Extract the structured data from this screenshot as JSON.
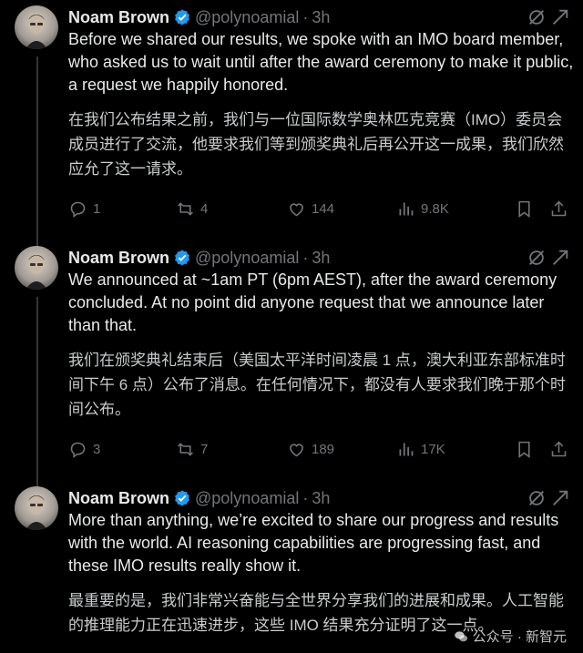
{
  "tweets": [
    {
      "author": "Noam Brown",
      "handle": "@polynoamial",
      "separator": "·",
      "time": "3h",
      "text_en": "Before we shared our results, we spoke with an IMO board member, who asked us to wait until after the award ceremony to make it public, a request we happily honored.",
      "text_zh": "在我们公布结果之前，我们与一位国际数学奥林匹克竞赛（IMO）委员会成员进行了交流，他要求我们等到颁奖典礼后再公开这一成果，我们欣然应允了这一请求。",
      "replies": "1",
      "reposts": "4",
      "likes": "144",
      "views": "9.8K"
    },
    {
      "author": "Noam Brown",
      "handle": "@polynoamial",
      "separator": "·",
      "time": "3h",
      "text_en": "We announced at ~1am PT (6pm AEST), after the award ceremony concluded. At no point did anyone request that we announce later than that.",
      "text_zh": "我们在颁奖典礼结束后（美国太平洋时间凌晨 1 点，澳大利亚东部标准时间下午 6 点）公布了消息。在任何情况下，都没有人要求我们晚于那个时间公布。",
      "replies": "3",
      "reposts": "7",
      "likes": "189",
      "views": "17K"
    },
    {
      "author": "Noam Brown",
      "handle": "@polynoamial",
      "separator": "·",
      "time": "3h",
      "text_en": "More than anything, we’re excited to share our progress and results with the world. AI reasoning capabilities are progressing fast, and these IMO results really show it.",
      "text_zh": "最重要的是，我们非常兴奋能与全世界分享我们的进展和成果。人工智能的推理能力正在迅速进步，这些 IMO 结果充分证明了这一点。"
    }
  ],
  "watermark": "公众号 · 新智元",
  "icons": {
    "verified": "verified-badge-icon",
    "grok": "grok-icon",
    "more": "more-icon",
    "reply": "reply-icon",
    "repost": "repost-icon",
    "like": "like-icon",
    "views": "views-icon",
    "bookmark": "bookmark-icon",
    "share": "share-icon"
  },
  "colors": {
    "background": "#000000",
    "text": "#e7e9ea",
    "muted": "#71767b",
    "verified": "#1d9bf0"
  }
}
